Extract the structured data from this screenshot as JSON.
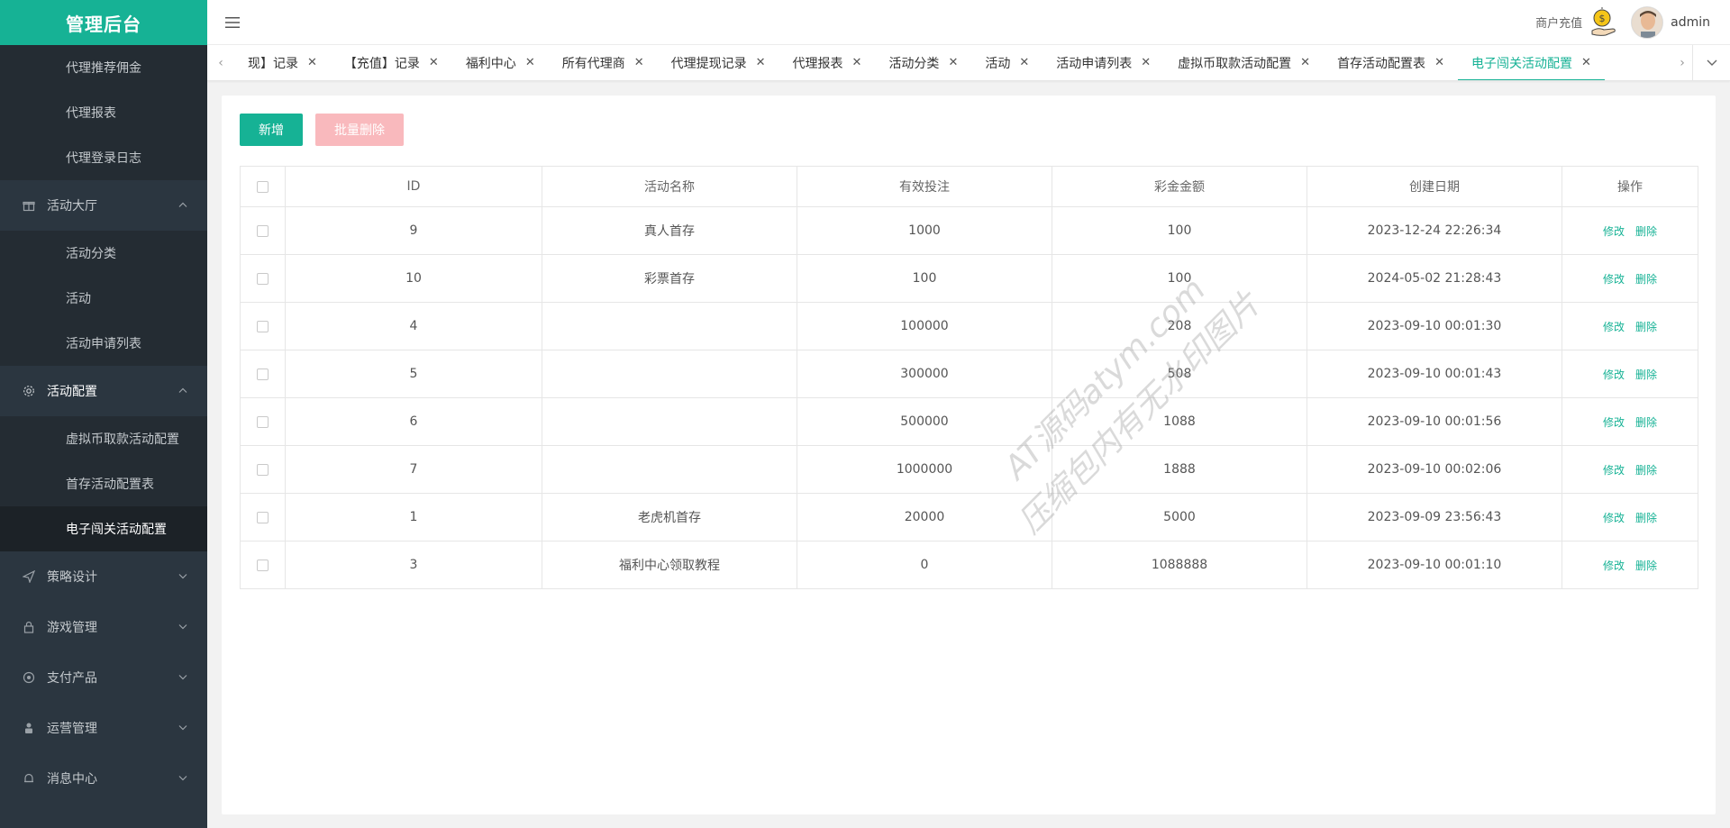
{
  "app": {
    "title": "管理后台"
  },
  "sidebar": {
    "top_items": [
      "代理推荐佣金",
      "代理报表",
      "代理登录日志"
    ],
    "groups": [
      {
        "label": "活动大厅",
        "icon": "gift-icon",
        "open": true,
        "children": [
          "活动分类",
          "活动",
          "活动申请列表"
        ]
      },
      {
        "label": "活动配置",
        "icon": "gear-icon",
        "open": true,
        "children": [
          "虚拟币取款活动配置",
          "首存活动配置表",
          "电子闯关活动配置"
        ]
      },
      {
        "label": "策略设计",
        "icon": "send-icon",
        "open": false,
        "children": []
      },
      {
        "label": "游戏管理",
        "icon": "lock-icon",
        "open": false,
        "children": []
      },
      {
        "label": "支付产品",
        "icon": "coin-icon",
        "open": false,
        "children": []
      },
      {
        "label": "运营管理",
        "icon": "user-icon",
        "open": false,
        "children": []
      },
      {
        "label": "消息中心",
        "icon": "bell-icon",
        "open": false,
        "children": []
      }
    ],
    "active_item": "电子闯关活动配置"
  },
  "header": {
    "recharge_label": "商户充值",
    "user_name": "admin"
  },
  "tabs": [
    {
      "label": "现】记录"
    },
    {
      "label": "【充值】记录"
    },
    {
      "label": "福利中心"
    },
    {
      "label": "所有代理商"
    },
    {
      "label": "代理提现记录"
    },
    {
      "label": "代理报表"
    },
    {
      "label": "活动分类"
    },
    {
      "label": "活动"
    },
    {
      "label": "活动申请列表"
    },
    {
      "label": "虚拟币取款活动配置"
    },
    {
      "label": "首存活动配置表"
    },
    {
      "label": "电子闯关活动配置",
      "active": true
    }
  ],
  "toolbar": {
    "add_label": "新增",
    "batch_delete_label": "批量删除"
  },
  "table": {
    "columns": [
      "ID",
      "活动名称",
      "有效投注",
      "彩金金额",
      "创建日期",
      "操作"
    ],
    "edit_label": "修改",
    "delete_label": "删除",
    "rows": [
      {
        "id": "9",
        "name": "真人首存",
        "bet": "1000",
        "bonus": "100",
        "created": "2023-12-24 22:26:34"
      },
      {
        "id": "10",
        "name": "彩票首存",
        "bet": "100",
        "bonus": "100",
        "created": "2024-05-02 21:28:43"
      },
      {
        "id": "4",
        "name": "",
        "bet": "100000",
        "bonus": "208",
        "created": "2023-09-10 00:01:30"
      },
      {
        "id": "5",
        "name": "",
        "bet": "300000",
        "bonus": "508",
        "created": "2023-09-10 00:01:43"
      },
      {
        "id": "6",
        "name": "",
        "bet": "500000",
        "bonus": "1088",
        "created": "2023-09-10 00:01:56"
      },
      {
        "id": "7",
        "name": "",
        "bet": "1000000",
        "bonus": "1888",
        "created": "2023-09-10 00:02:06"
      },
      {
        "id": "1",
        "name": "老虎机首存",
        "bet": "20000",
        "bonus": "5000",
        "created": "2023-09-09 23:56:43"
      },
      {
        "id": "3",
        "name": "福利中心领取教程",
        "bet": "0",
        "bonus": "1088888",
        "created": "2023-09-10 00:01:10"
      }
    ]
  },
  "watermark": {
    "line1": "AT源码atym.com",
    "line2": "压缩包内有无水印图片"
  },
  "colors": {
    "brand": "#16b295",
    "sidebar_bg": "#2b3640",
    "danger_disabled": "#f9b9bd"
  }
}
